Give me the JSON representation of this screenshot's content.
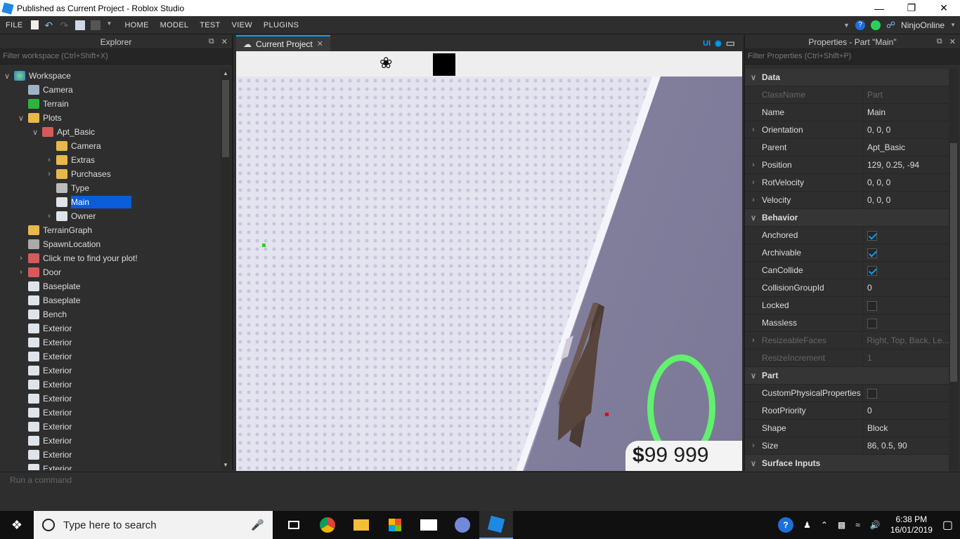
{
  "window": {
    "title": "Published as Current Project - Roblox Studio"
  },
  "menu": {
    "file": "FILE",
    "tabs": [
      "HOME",
      "MODEL",
      "TEST",
      "VIEW",
      "PLUGINS"
    ],
    "user": "NinjoOnline"
  },
  "explorer": {
    "title": "Explorer",
    "filter_placeholder": "Filter workspace (Ctrl+Shift+X)",
    "items": [
      {
        "label": "Workspace",
        "depth": 0,
        "arrow": "open",
        "icon": "globe-icon"
      },
      {
        "label": "Camera",
        "depth": 1,
        "arrow": "",
        "icon": "camera-icon"
      },
      {
        "label": "Terrain",
        "depth": 1,
        "arrow": "",
        "icon": "terrain-icon"
      },
      {
        "label": "Plots",
        "depth": 1,
        "arrow": "open",
        "icon": "folder-icon"
      },
      {
        "label": "Apt_Basic",
        "depth": 2,
        "arrow": "open",
        "icon": "model-icon"
      },
      {
        "label": "Camera",
        "depth": 3,
        "arrow": "",
        "icon": "folder-icon"
      },
      {
        "label": "Extras",
        "depth": 3,
        "arrow": "closed",
        "icon": "folder-icon"
      },
      {
        "label": "Purchases",
        "depth": 3,
        "arrow": "closed",
        "icon": "folder-icon"
      },
      {
        "label": "Type",
        "depth": 3,
        "arrow": "",
        "icon": "string-value-icon"
      },
      {
        "label": "Main",
        "depth": 3,
        "arrow": "",
        "icon": "part-icon",
        "selected": true
      },
      {
        "label": "Owner",
        "depth": 3,
        "arrow": "closed",
        "icon": "part-icon"
      },
      {
        "label": "TerrainGraph",
        "depth": 1,
        "arrow": "",
        "icon": "folder-icon"
      },
      {
        "label": "SpawnLocation",
        "depth": 1,
        "arrow": "",
        "icon": "spawn-icon"
      },
      {
        "label": "Click me to find your plot!",
        "depth": 1,
        "arrow": "closed",
        "icon": "model-icon"
      },
      {
        "label": "Door",
        "depth": 1,
        "arrow": "closed",
        "icon": "model-icon"
      },
      {
        "label": "Baseplate",
        "depth": 1,
        "arrow": "",
        "icon": "part-icon"
      },
      {
        "label": "Baseplate",
        "depth": 1,
        "arrow": "",
        "icon": "part-icon"
      },
      {
        "label": "Bench",
        "depth": 1,
        "arrow": "",
        "icon": "part-icon"
      },
      {
        "label": "Exterior",
        "depth": 1,
        "arrow": "",
        "icon": "part-icon"
      },
      {
        "label": "Exterior",
        "depth": 1,
        "arrow": "",
        "icon": "part-icon"
      },
      {
        "label": "Exterior",
        "depth": 1,
        "arrow": "",
        "icon": "part-icon"
      },
      {
        "label": "Exterior",
        "depth": 1,
        "arrow": "",
        "icon": "part-icon"
      },
      {
        "label": "Exterior",
        "depth": 1,
        "arrow": "",
        "icon": "part-icon"
      },
      {
        "label": "Exterior",
        "depth": 1,
        "arrow": "",
        "icon": "part-icon"
      },
      {
        "label": "Exterior",
        "depth": 1,
        "arrow": "",
        "icon": "part-icon"
      },
      {
        "label": "Exterior",
        "depth": 1,
        "arrow": "",
        "icon": "part-icon"
      },
      {
        "label": "Exterior",
        "depth": 1,
        "arrow": "",
        "icon": "part-icon"
      },
      {
        "label": "Exterior",
        "depth": 1,
        "arrow": "",
        "icon": "part-icon"
      },
      {
        "label": "Exterior",
        "depth": 1,
        "arrow": "",
        "icon": "part-icon"
      }
    ]
  },
  "viewport": {
    "tab_label": "Current Project",
    "ui_toggle": "UI",
    "money": "99 999",
    "currency": "$"
  },
  "properties": {
    "title": "Properties - Part \"Main\"",
    "filter_placeholder": "Filter Properties (Ctrl+Shift+P)",
    "rows": [
      {
        "type": "cat",
        "name": "Data"
      },
      {
        "name": "ClassName",
        "value": "Part",
        "dim": true
      },
      {
        "name": "Name",
        "value": "Main"
      },
      {
        "name": "Orientation",
        "value": "0, 0, 0",
        "expand": true
      },
      {
        "name": "Parent",
        "value": "Apt_Basic"
      },
      {
        "name": "Position",
        "value": "129, 0.25, -94",
        "expand": true
      },
      {
        "name": "RotVelocity",
        "value": "0, 0, 0",
        "expand": true
      },
      {
        "name": "Velocity",
        "value": "0, 0, 0",
        "expand": true
      },
      {
        "type": "cat",
        "name": "Behavior"
      },
      {
        "name": "Anchored",
        "check": true
      },
      {
        "name": "Archivable",
        "check": true
      },
      {
        "name": "CanCollide",
        "check": true
      },
      {
        "name": "CollisionGroupId",
        "value": "0"
      },
      {
        "name": "Locked",
        "check": false
      },
      {
        "name": "Massless",
        "check": false
      },
      {
        "name": "ResizeableFaces",
        "value": "Right, Top, Back, Le...",
        "dim": true,
        "expand": true
      },
      {
        "name": "ResizeIncrement",
        "value": "1",
        "dim": true
      },
      {
        "type": "cat",
        "name": "Part"
      },
      {
        "name": "CustomPhysicalProperties",
        "check": false
      },
      {
        "name": "RootPriority",
        "value": "0"
      },
      {
        "name": "Shape",
        "value": "Block"
      },
      {
        "name": "Size",
        "value": "86, 0.5, 90",
        "expand": true
      },
      {
        "type": "cat",
        "name": "Surface Inputs"
      }
    ]
  },
  "command_bar": {
    "placeholder": "Run a command"
  },
  "taskbar": {
    "search_placeholder": "Type here to search",
    "time": "6:38 PM",
    "date": "16/01/2019"
  },
  "colors": {
    "accent": "#00a2ff",
    "selection": "#0b5cd7",
    "ring": "#62f06f"
  }
}
